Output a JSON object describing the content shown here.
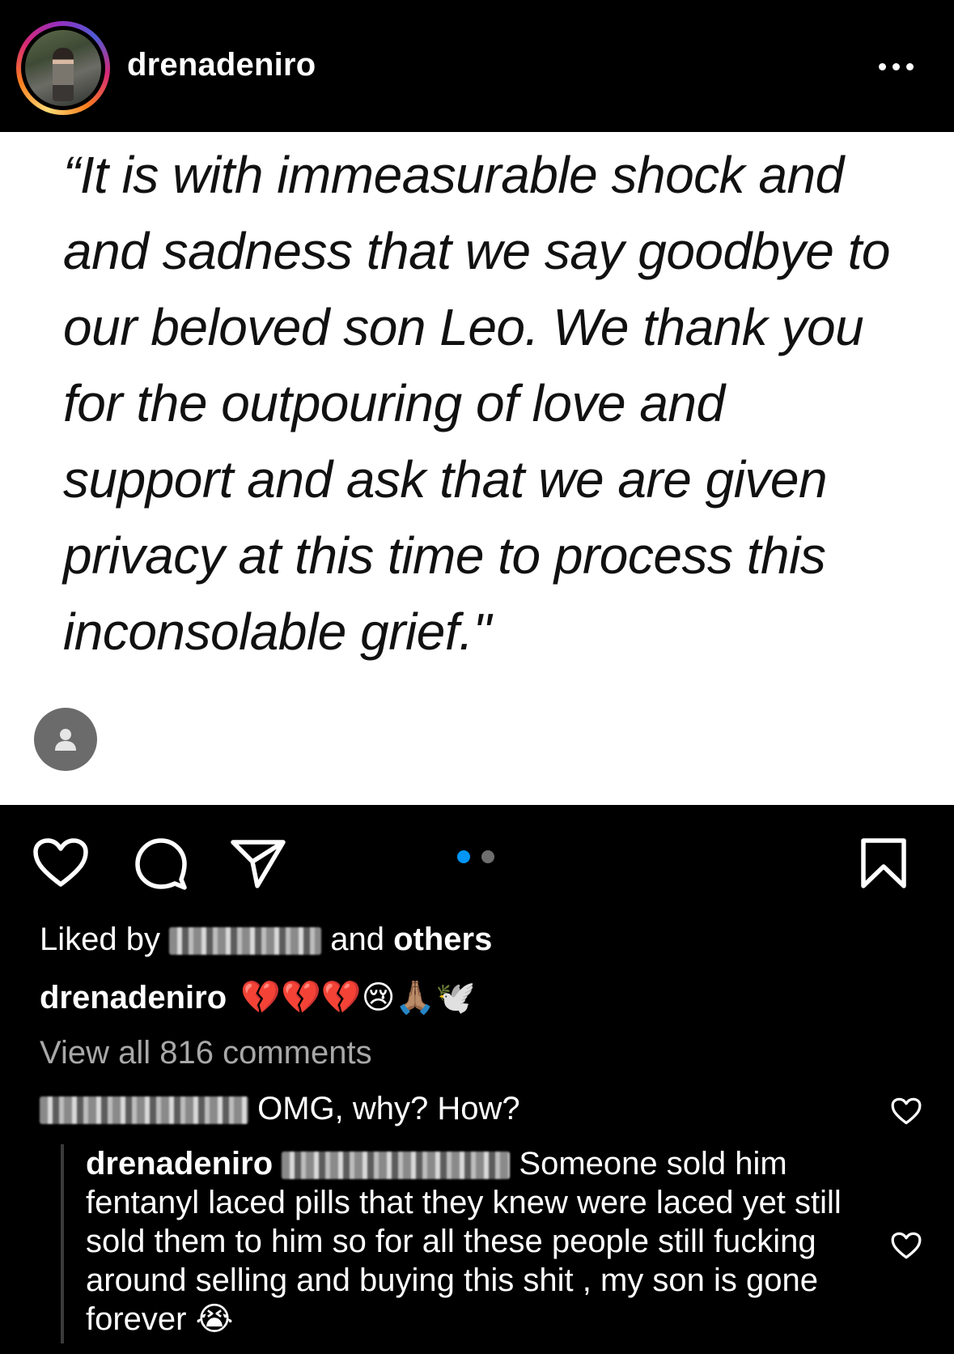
{
  "header": {
    "username": "drenadeniro",
    "more_icon": "more-horizontal-icon"
  },
  "post": {
    "image_text": "“It is with immeasurable shock and and sadness that we say goodbye to our beloved son Leo. We thank you for the outpouring of love and support and ask that we are given privacy at this time to process this inconsolable grief.\"",
    "tag_icon": "person-tag-icon",
    "carousel": {
      "total": 2,
      "current": 1,
      "active_color": "#0095f6",
      "inactive_color": "#6e6e6e"
    }
  },
  "actions": {
    "like_icon": "heart-icon",
    "comment_icon": "comment-bubble-icon",
    "share_icon": "paper-plane-icon",
    "save_icon": "bookmark-icon"
  },
  "likes": {
    "prefix": "Liked by",
    "middle": "and",
    "suffix": "others"
  },
  "caption": {
    "username": "drenadeniro",
    "text": "💔💔💔😢🙏🏽🕊️"
  },
  "comments": {
    "view_all": "View all 816 comments",
    "first": {
      "text": "OMG, why? How?"
    },
    "reply": {
      "username": "drenadeniro",
      "text": "Someone sold him fentanyl laced pills that they knew were laced yet still sold them to him so for all these people still fucking around selling and buying this shit , my son is gone forever 😭"
    }
  }
}
